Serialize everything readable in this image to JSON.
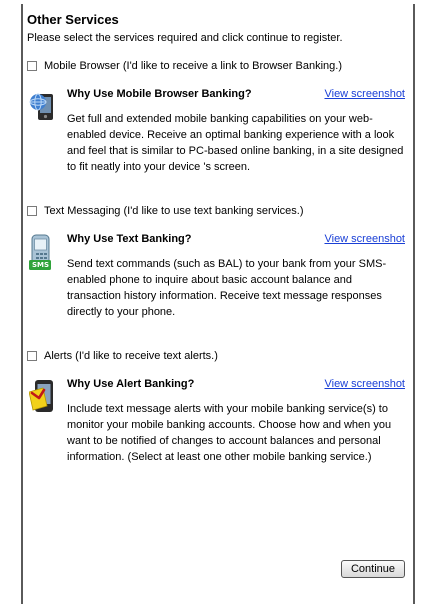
{
  "title": "Other Services",
  "intro": "Please select the services required and click continue to register.",
  "services": [
    {
      "option": "Mobile Browser (I'd like to receive a link to Browser Banking.)",
      "heading": "Why Use Mobile Browser Banking?",
      "link": "View screenshot",
      "description": "Get full and extended mobile banking capabilities on your web-enabled device. Receive an optimal banking experience with a look and feel that is similar to PC-based online banking, in a site designed to fit neatly into your device 's screen.",
      "icon": "mobile-browser-icon"
    },
    {
      "option": "Text Messaging (I'd like to use text banking services.)",
      "heading": "Why Use Text Banking?",
      "link": "View screenshot",
      "description": "Send text commands (such as BAL) to your bank from your SMS-enabled phone to inquire about basic account balance and transaction history information. Receive text message responses directly to your phone.",
      "icon": "sms-phone-icon",
      "icon_text": "SMS"
    },
    {
      "option": "Alerts (I'd like to receive text alerts.)",
      "heading": "Why Use Alert Banking?",
      "link": "View screenshot",
      "description": "Include text message alerts with your mobile banking service(s) to monitor your mobile banking accounts. Choose how and when you want to be notified of changes to account balances and personal information. (Select at least one other mobile banking service.)",
      "icon": "alert-phone-icon"
    }
  ],
  "continue_label": "Continue"
}
